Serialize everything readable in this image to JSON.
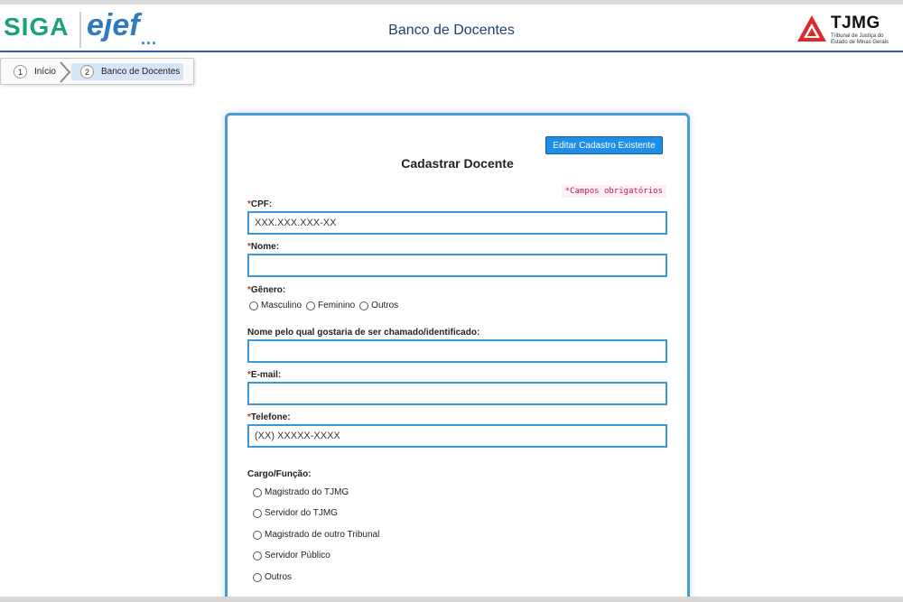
{
  "header": {
    "logo_siga": "SIGA",
    "logo_ejef": "ejef",
    "logo_ejef_dots": "...",
    "title": "Banco de Docentes",
    "tjmg_name": "TJMG",
    "tjmg_subtitle": "Tribunal de Justiça do Estado de Minas Gerais"
  },
  "breadcrumb": {
    "steps": [
      {
        "number": "1",
        "label": "Início"
      },
      {
        "number": "2",
        "label": "Banco de Docentes"
      }
    ]
  },
  "form": {
    "edit_button": "Editar Cadastro Existente",
    "title": "Cadastrar Docente",
    "required_note": "*Campos obrigatórios",
    "cpf": {
      "label": "CPF:",
      "placeholder": "XXX.XXX.XXX-XX"
    },
    "nome": {
      "label": "Nome:",
      "placeholder": ""
    },
    "genero": {
      "label": "Gênero:",
      "options": [
        "Masculino",
        "Feminino",
        "Outros"
      ]
    },
    "nome_social": {
      "label": "Nome pelo qual gostaria de ser chamado/identificado:",
      "placeholder": ""
    },
    "email": {
      "label": "E-mail:",
      "placeholder": ""
    },
    "telefone": {
      "label": "Telefone:",
      "placeholder": "(XX) XXXXX-XXXX"
    },
    "cargo": {
      "label": "Cargo/Função:",
      "options": [
        "Magistrado do TJMG",
        "Servidor do TJMG",
        "Magistrado de outro Tribunal",
        "Servidor Público",
        "Outros"
      ]
    }
  },
  "colors": {
    "accent_blue": "#1e8ee8",
    "field_border": "#3a97d9",
    "siga_green": "#1aa37a",
    "tjmg_red": "#d62c2c"
  }
}
